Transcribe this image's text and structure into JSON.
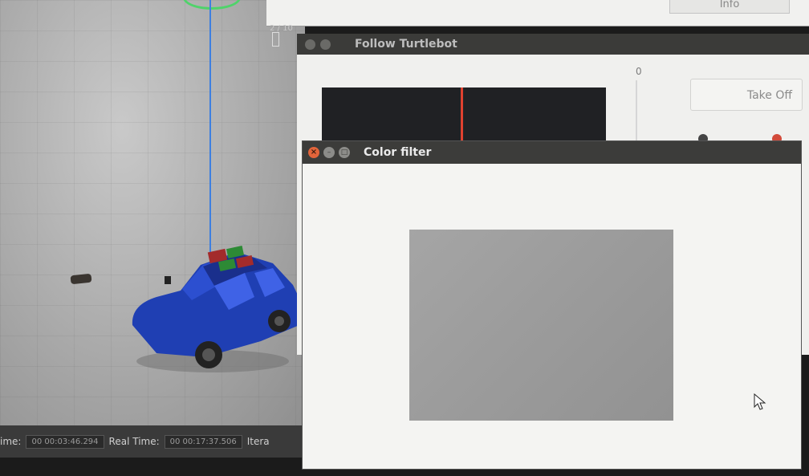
{
  "gazebo": {
    "status_bar": {
      "sim_time_label": "ime:",
      "sim_time_value": "00 00:03:46.294",
      "real_time_label": "Real Time:",
      "real_time_value": "00 00:17:37.506",
      "iterations_label": "Itera"
    }
  },
  "top_window": {
    "info_button": "Info",
    "corner_text": "2 / 10"
  },
  "follow_window": {
    "title": "Follow Turtlebot",
    "slider_value": "0",
    "take_off_button": "Take Off"
  },
  "color_filter_window": {
    "title": "Color filter",
    "close_glyph": "×",
    "minimize_glyph": "–",
    "maximize_glyph": "□"
  },
  "colors": {
    "accent_red": "#e0412f",
    "close_orange": "#e2643a",
    "car_blue": "#1f3fb3"
  },
  "icons": [
    "close-icon",
    "minimize-icon",
    "maximize-icon",
    "mouse-pointer-icon"
  ]
}
